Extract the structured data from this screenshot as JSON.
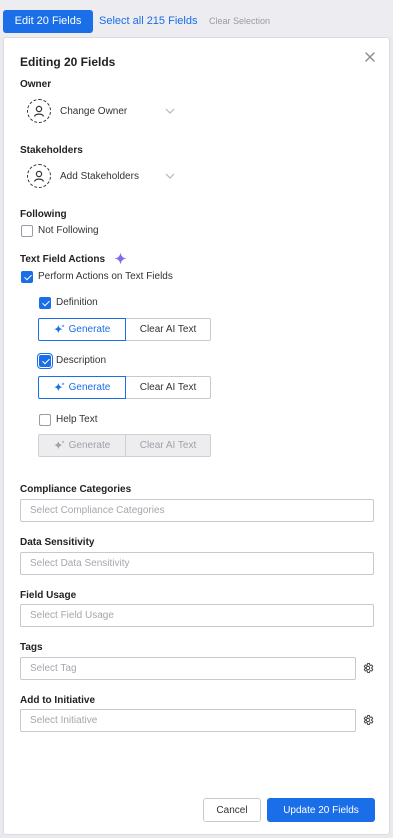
{
  "topbar": {
    "edit_button": "Edit 20 Fields",
    "select_all": "Select all 215 Fields",
    "clear_selection": "Clear Selection"
  },
  "panel": {
    "title": "Editing 20 Fields",
    "owner": {
      "label": "Owner",
      "action": "Change Owner"
    },
    "stakeholders": {
      "label": "Stakeholders",
      "action": "Add Stakeholders"
    },
    "following": {
      "label": "Following",
      "option": "Not Following",
      "checked": false
    },
    "text_field_actions": {
      "label": "Text Field Actions",
      "perform": {
        "label": "Perform Actions on Text Fields",
        "checked": true
      },
      "fields": [
        {
          "label": "Definition",
          "checked": true,
          "enabled": true
        },
        {
          "label": "Description",
          "checked": true,
          "enabled": true
        },
        {
          "label": "Help Text",
          "checked": false,
          "enabled": false
        }
      ],
      "generate_label": "Generate",
      "clear_label": "Clear AI Text"
    },
    "compliance": {
      "label": "Compliance Categories",
      "placeholder": "Select Compliance Categories"
    },
    "sensitivity": {
      "label": "Data Sensitivity",
      "placeholder": "Select Data Sensitivity"
    },
    "usage": {
      "label": "Field Usage",
      "placeholder": "Select Field Usage"
    },
    "tags": {
      "label": "Tags",
      "placeholder": "Select Tag"
    },
    "initiative": {
      "label": "Add to Initiative",
      "placeholder": "Select Initiative"
    },
    "footer": {
      "cancel": "Cancel",
      "update": "Update 20 Fields"
    }
  },
  "colors": {
    "accent": "#1a6ee8",
    "ai_sparkle": "#7b6cf0"
  },
  "icons": {
    "close": "close-icon",
    "user": "user-icon",
    "chevron": "chevron-down-icon",
    "sparkle": "sparkle-icon",
    "gear": "gear-icon"
  }
}
